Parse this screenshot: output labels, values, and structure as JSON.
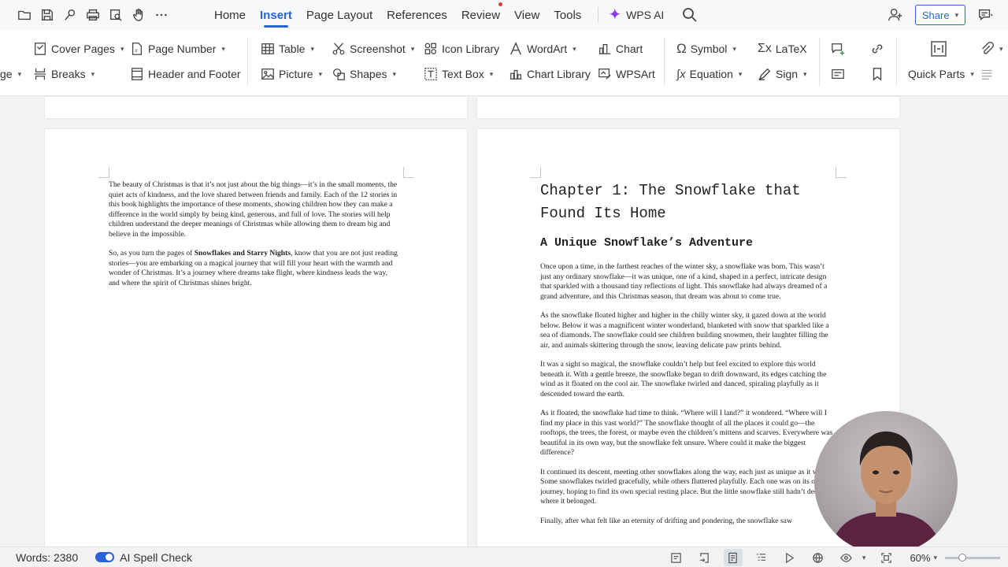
{
  "menubar": {
    "items": [
      "Home",
      "Insert",
      "Page Layout",
      "References",
      "Review",
      "View",
      "Tools"
    ],
    "active": "Insert",
    "wps_ai": "WPS AI",
    "share": "Share"
  },
  "ribbon": {
    "partial_left": "ge",
    "cover_pages": "Cover Pages",
    "breaks": "Breaks",
    "page_number": "Page Number",
    "header_footer": "Header and Footer",
    "table": "Table",
    "picture": "Picture",
    "screenshot": "Screenshot",
    "shapes": "Shapes",
    "icon_library": "Icon Library",
    "text_box": "Text Box",
    "wordart": "WordArt",
    "chart_library": "Chart Library",
    "chart": "Chart",
    "wpsart": "WPSArt",
    "symbol": "Symbol",
    "equation": "Equation",
    "latex": "LaTeX",
    "sign": "Sign",
    "quick_parts": "Quick Parts"
  },
  "left_page": {
    "p1": "The beauty of Christmas is that it’s not just about the big things—it’s in the small moments, the quiet acts of kindness, and the love shared between friends and family. Each of the 12 stories in this book highlights the importance of these moments, showing children how they can make a difference in the world simply by being kind, generous, and full of love. The stories will help children understand the deeper meanings of Christmas while allowing them to dream big and believe in the impossible.",
    "p2_pre": "So, as you turn the pages of ",
    "p2_bold": "Snowflakes and Starry Nights",
    "p2_post": ", know that you are not just reading stories—you are embarking on a magical journey that will fill your heart with the warmth and wonder of Christmas. It’s a journey where dreams take flight, where kindness leads the way, and where the spirit of Christmas shines bright."
  },
  "right_page": {
    "chapter_title": "Chapter 1: The Snowflake that Found Its Home",
    "subtitle": "A Unique Snowflake’s Adventure",
    "paragraphs": [
      "Once upon a time, in the farthest reaches of the winter sky, a snowflake was born. This wasn’t just any ordinary snowflake—it was unique, one of a kind, shaped in a perfect, intricate design that sparkled with a thousand tiny reflections of light. This snowflake had always dreamed of a grand adventure, and this Christmas season, that dream was about to come true.",
      "As the snowflake floated higher and higher in the chilly winter sky, it gazed down at the world below. Below it was a magnificent winter wonderland, blanketed with snow that sparkled like a sea of diamonds. The snowflake could see children building snowmen, their laughter filling the air, and animals skittering through the snow, leaving delicate paw prints behind.",
      "It was a sight so magical, the snowflake couldn’t help but feel excited to explore this world beneath it. With a gentle breeze, the snowflake began to drift downward, its edges catching the wind as it floated on the cool air. The snowflake twirled and danced, spiraling playfully as it descended toward the earth.",
      "As it floated, the snowflake had time to think. “Where will I land?” it wondered. “Where will I find my place in this vast world?” The snowflake thought of all the places it could go—the rooftops, the trees, the forest, or maybe even the children’s mittens and scarves. Everywhere was beautiful in its own way, but the snowflake felt unsure. Where could it make the biggest difference?",
      "It continued its descent, meeting other snowflakes along the way, each just as unique as it was. Some snowflakes twirled gracefully, while others fluttered playfully. Each one was on its own journey, hoping to find its own special resting place. But the little snowflake still hadn’t decided where it belonged.",
      "Finally, after what felt like an eternity of drifting and pondering, the snowflake saw"
    ]
  },
  "statusbar": {
    "words": "Words: 2380",
    "spell_check": "AI Spell Check",
    "zoom": "60%",
    "zoom_level_percent": 60
  },
  "colors": {
    "accent": "#2a62d9",
    "wps_ai_star": "#8b3cf0",
    "page_bg": "#ffffff",
    "workspace_bg": "#f1f2f4"
  }
}
